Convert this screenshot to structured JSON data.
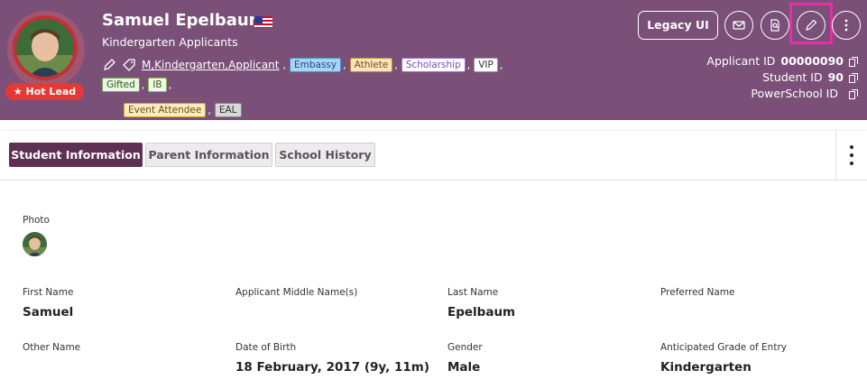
{
  "header": {
    "name": "Samuel Epelbaum",
    "subtitle": "Kindergarten Applicants",
    "hot_lead": "★ Hot Lead",
    "tag_link": "M,Kindergarten,Applicant",
    "tags": [
      {
        "label": "Embassy",
        "bg": "#a8d4f5",
        "border": "#4a90c4",
        "color": "#1e4f7a"
      },
      {
        "label": "Athlete",
        "bg": "#fde5c0",
        "border": "#c9892c",
        "color": "#7a4d10"
      },
      {
        "label": "Scholarship",
        "bg": "#ffffff",
        "border": "#9b6bd2",
        "color": "#7a4cb0"
      },
      {
        "label": "VIP",
        "bg": "#ffffff",
        "border": "#999999",
        "color": "#333333"
      },
      {
        "label": "Gifted",
        "bg": "#eaf6e4",
        "border": "#6aa84f",
        "color": "#2f5a1f"
      },
      {
        "label": "IB",
        "bg": "#f3f8e8",
        "border": "#8bbf4f",
        "color": "#3c5a16"
      },
      {
        "label": "Event Attendee",
        "bg": "#fbecc0",
        "border": "#c9a22c",
        "color": "#6b5010"
      },
      {
        "label": "EAL",
        "bg": "#d8d8d8",
        "border": "#888888",
        "color": "#333333"
      }
    ],
    "legacy_button": "Legacy UI",
    "ids": [
      {
        "label": "Applicant ID",
        "value": "00000090"
      },
      {
        "label": "Student ID",
        "value": "90"
      },
      {
        "label": "PowerSchool ID",
        "value": ""
      }
    ]
  },
  "tabs": [
    {
      "label": "Student Information",
      "active": true
    },
    {
      "label": "Parent Information",
      "active": false
    },
    {
      "label": "School History",
      "active": false
    }
  ],
  "content": {
    "photo_label": "Photo",
    "fields": [
      {
        "label": "First Name",
        "value": "Samuel"
      },
      {
        "label": "Applicant Middle Name(s)",
        "value": ""
      },
      {
        "label": "Last Name",
        "value": "Epelbaum"
      },
      {
        "label": "Preferred Name",
        "value": ""
      },
      {
        "label": "Other Name",
        "value": ""
      },
      {
        "label": "Date of Birth",
        "value": "18 February, 2017 (9y, 11m)"
      },
      {
        "label": "Gender",
        "value": "Male"
      },
      {
        "label": "Anticipated Grade of Entry",
        "value": "Kindergarten"
      }
    ]
  },
  "colors": {
    "header_bg": "#7a5078",
    "active_tab": "#5e3054",
    "hot_lead": "#e53935",
    "highlight": "#e92ca8"
  }
}
